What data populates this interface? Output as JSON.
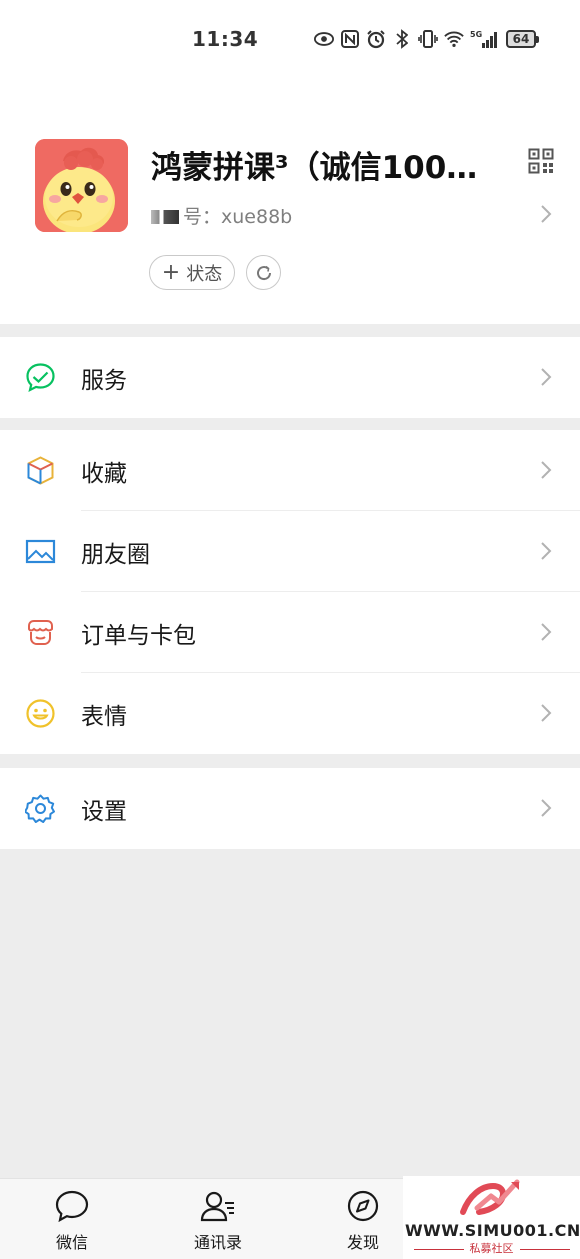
{
  "status_bar": {
    "time": "11:34",
    "icons": [
      "eye-icon",
      "nfc-icon",
      "alarm-icon",
      "bluetooth-icon",
      "vibrate-icon",
      "wifi-icon",
      "5g-signal-icon"
    ],
    "network": "5G",
    "battery": "64"
  },
  "profile": {
    "nickname": "鸿蒙拼课³（诚信100…",
    "wechat_id_label": "号：",
    "wechat_id_value": "xue88b",
    "status_button": "状态",
    "status_plus": "+"
  },
  "menu": {
    "services": {
      "label": "服务",
      "icon": "services-icon",
      "color": "#07c160"
    },
    "favorites": {
      "label": "收藏",
      "icon": "favorites-cube-icon"
    },
    "moments": {
      "label": "朋友圈",
      "icon": "moments-image-icon",
      "color": "#2c88d9"
    },
    "orders": {
      "label": "订单与卡包",
      "icon": "orders-cards-icon",
      "color": "#e0614f"
    },
    "stickers": {
      "label": "表情",
      "icon": "sticker-smile-icon",
      "color": "#f0c22b"
    },
    "settings": {
      "label": "设置",
      "icon": "settings-gear-icon",
      "color": "#2c88d9"
    }
  },
  "tabbar": {
    "tabs": [
      {
        "label": "微信",
        "icon": "chat-bubble-icon"
      },
      {
        "label": "通讯录",
        "icon": "contacts-icon"
      },
      {
        "label": "发现",
        "icon": "compass-icon"
      }
    ]
  },
  "watermark": {
    "text": "WWW.SIMU001.CN",
    "subtitle": "私募社区"
  }
}
